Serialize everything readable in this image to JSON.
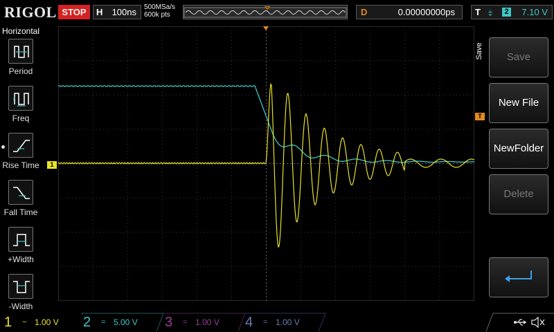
{
  "header": {
    "brand": "RIGOL",
    "run_status": "STOP",
    "timebase_label": "H",
    "timebase_value": "100ns",
    "sample_rate": "500MSa/s",
    "memory_depth": "600k pts",
    "delay_label": "D",
    "delay_value": "0.00000000ps",
    "trigger_label": "T",
    "trigger_edge": "falling-edge-icon",
    "trigger_source": "2",
    "trigger_level": "7.10 V"
  },
  "left_menu": {
    "title": "Horizontal",
    "items": [
      {
        "label": "Period",
        "icon": "period-icon"
      },
      {
        "label": "Freq",
        "icon": "frequency-icon"
      },
      {
        "label": "Rise Time",
        "icon": "rise-time-icon"
      },
      {
        "label": "Fall Time",
        "icon": "fall-time-icon"
      },
      {
        "label": "+Width",
        "icon": "positive-width-icon"
      },
      {
        "label": "-Width",
        "icon": "negative-width-icon"
      }
    ]
  },
  "markers": {
    "ch1_ground": "1",
    "trigger_level": "T"
  },
  "right_menu": {
    "tab": "Save",
    "buttons": [
      {
        "label": "Save",
        "enabled": false
      },
      {
        "label": "New File",
        "enabled": true
      },
      {
        "label": "NewFolder",
        "enabled": true
      },
      {
        "label": "Delete",
        "enabled": false
      }
    ],
    "enter_icon": "enter-icon"
  },
  "channels": [
    {
      "num": "1",
      "coupling": "~",
      "scale": "1.00 V",
      "color": "#e9e22a"
    },
    {
      "num": "2",
      "coupling": "=",
      "scale": "5.00 V",
      "color": "#3ec7c7"
    },
    {
      "num": "3",
      "coupling": "=",
      "scale": "1.00 V",
      "color": "#9a3d9a"
    },
    {
      "num": "4",
      "coupling": "=",
      "scale": "1.00 V",
      "color": "#6a7db6"
    }
  ],
  "colors": {
    "stop": "#d42222",
    "ch1": "#e9e22a",
    "ch2": "#3ec7c7",
    "trigger": "#e38a21"
  }
}
